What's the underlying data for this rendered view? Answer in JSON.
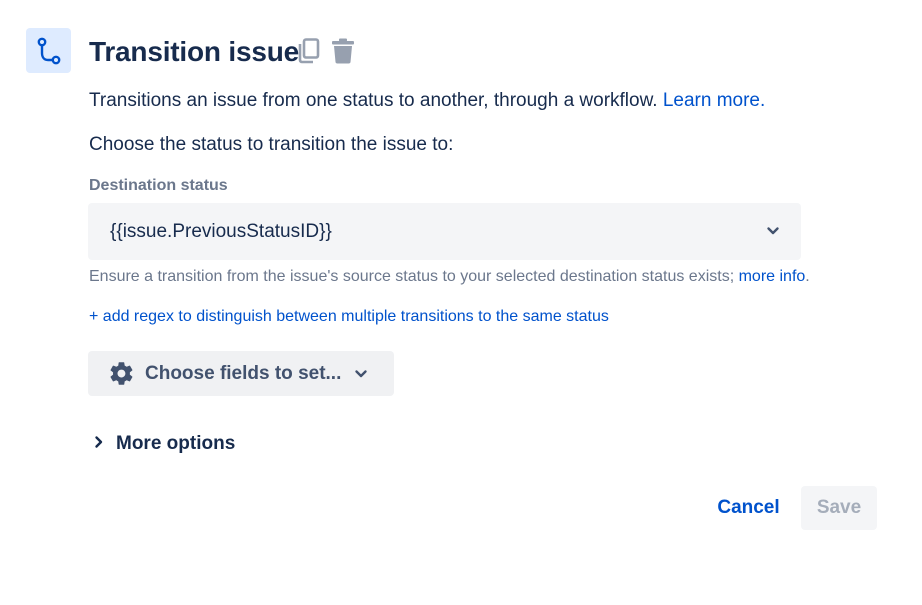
{
  "header": {
    "icon": "transition-icon",
    "title": "Transition issue",
    "actions": [
      {
        "icon": "copy-icon"
      },
      {
        "icon": "trash-icon"
      }
    ]
  },
  "description": {
    "text": "Transitions an issue from one status to another, through a workflow. ",
    "link": "Learn more."
  },
  "prompt": "Choose the status to transition the issue to:",
  "destination": {
    "label": "Destination status",
    "value": "{{issue.PreviousStatusID}}",
    "help_text": "Ensure a transition from the issue's source status to your selected destination status exists; ",
    "help_link": "more info",
    "help_suffix": "."
  },
  "regex_link": "+ add regex to distinguish between multiple transitions to the same status",
  "fields_button": {
    "icon": "gear-icon",
    "label": "Choose fields to set..."
  },
  "more_options": {
    "label": "More options"
  },
  "footer": {
    "cancel_label": "Cancel",
    "save_label": "Save"
  },
  "colors": {
    "primary_text": "#172b4d",
    "link": "#0052cc",
    "subtle_text": "#6b778c",
    "field_background": "#f4f5f7",
    "icon_background": "#deebff",
    "disabled_text": "#a5adba"
  }
}
